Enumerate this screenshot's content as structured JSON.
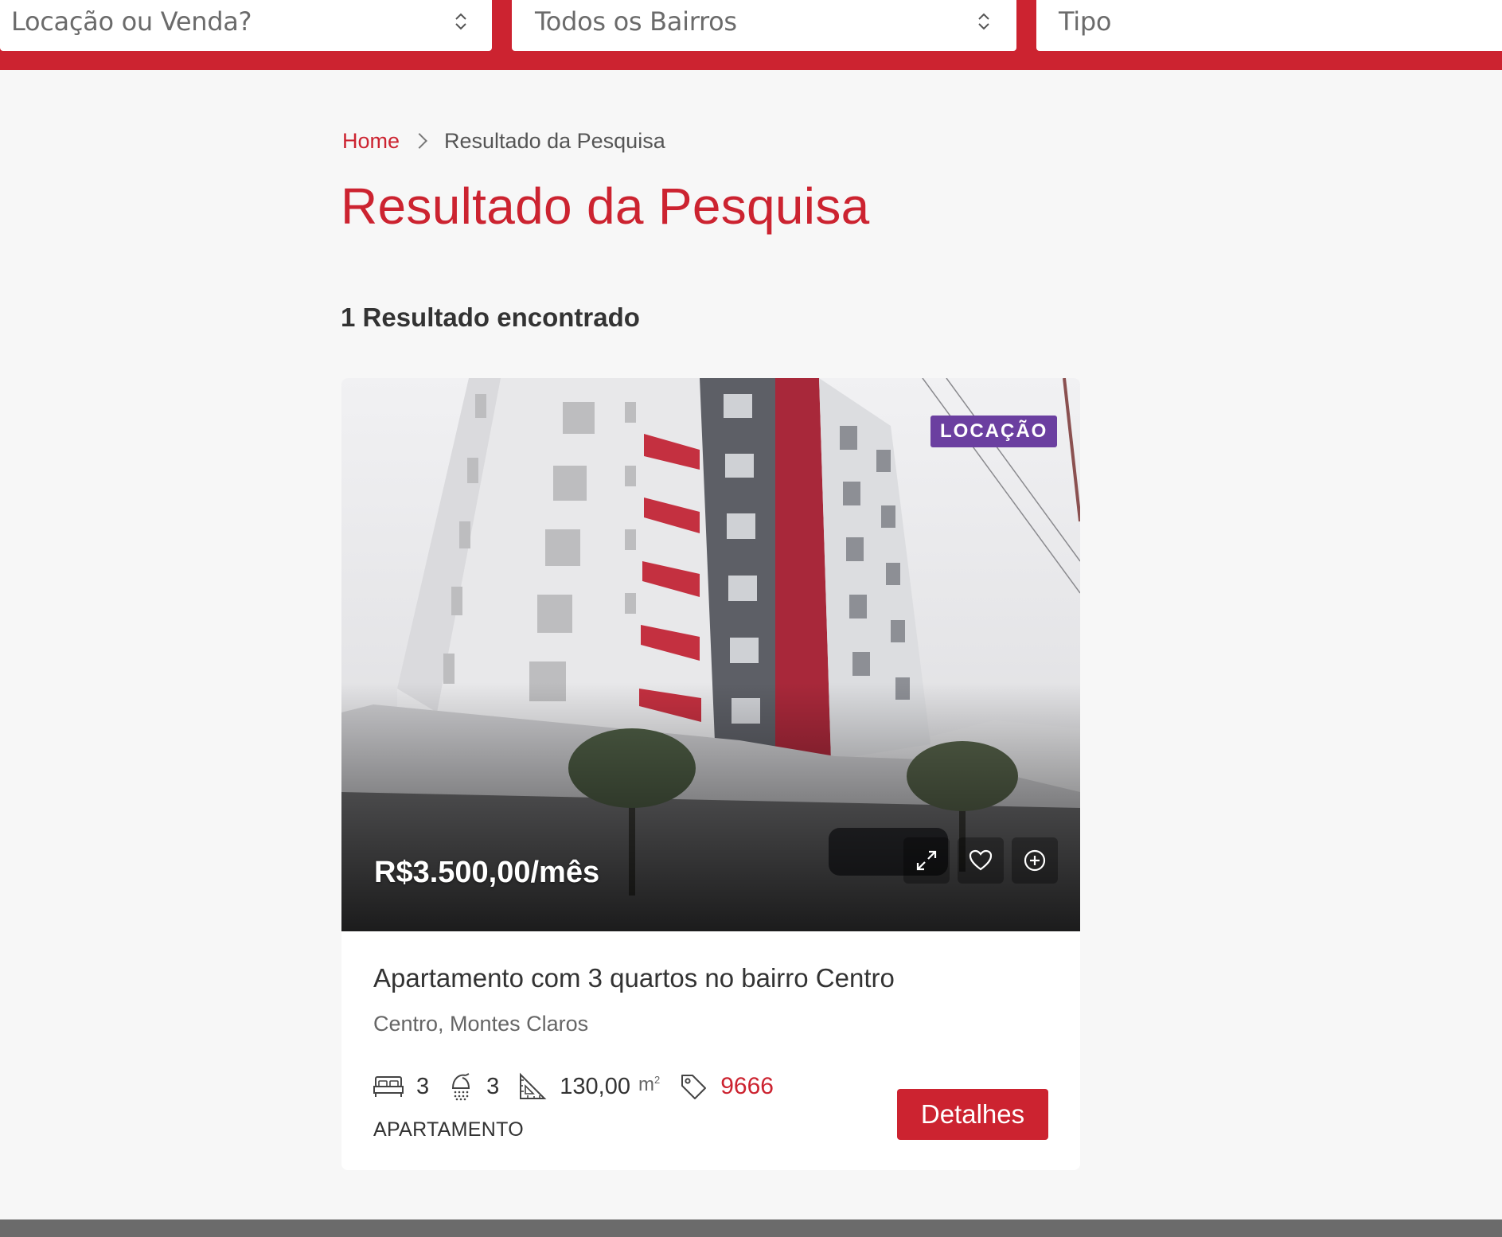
{
  "search": {
    "operation_select": "Locação ou Venda?",
    "neighborhood_select": "Todos os Bairros",
    "type_select": "Tipo"
  },
  "breadcrumb": {
    "home": "Home",
    "current": "Resultado da Pesquisa"
  },
  "page_title": "Resultado da Pesquisa",
  "results_count": "1 Resultado encontrado",
  "listing": {
    "badge": "LOCAÇÃO",
    "price": "R$3.500,00/mês",
    "title": "Apartamento com 3 quartos no bairro Centro",
    "location": "Centro, Montes Claros",
    "bedrooms": "3",
    "bathrooms": "3",
    "area": "130,00",
    "area_unit": "m",
    "area_unit_sup": "2",
    "code": "9666",
    "property_type": "APARTAMENTO",
    "details_label": "Detalhes",
    "icons": {
      "bed": "bed-icon",
      "shower": "shower-icon",
      "area": "set-square-icon",
      "tag": "tag-icon",
      "expand": "expand-icon",
      "favorite": "heart-icon",
      "compare": "plus-circle-icon"
    }
  },
  "colors": {
    "brand_red": "#cc2330",
    "badge_purple": "#6b3fa0",
    "page_bg": "#f7f7f7",
    "footer_gray": "#6b6b6b"
  }
}
